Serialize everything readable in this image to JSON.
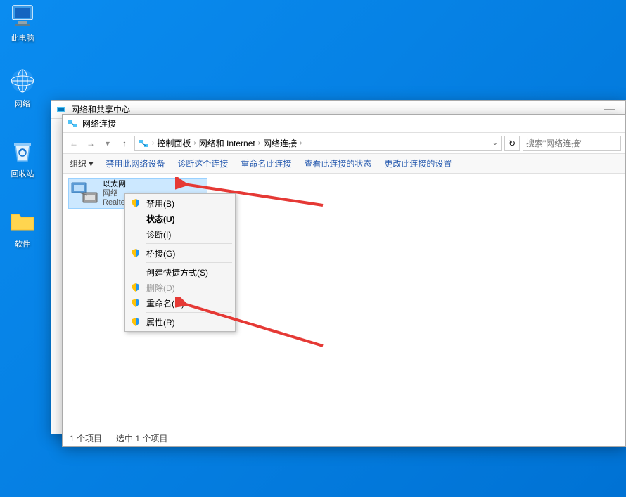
{
  "desktop": {
    "icons": [
      {
        "name": "此电脑"
      },
      {
        "name": "网络"
      },
      {
        "name": "回收站"
      },
      {
        "name": "软件"
      }
    ]
  },
  "window_back": {
    "title": "网络和共享中心"
  },
  "window_front": {
    "title": "网络连接",
    "breadcrumb": {
      "items": [
        "控制面板",
        "网络和 Internet",
        "网络连接"
      ]
    },
    "search_placeholder": "搜索\"网络连接\"",
    "toolbar": {
      "organize": "组织 ▾",
      "disable": "禁用此网络设备",
      "diagnose": "诊断这个连接",
      "rename": "重命名此连接",
      "status": "查看此连接的状态",
      "change": "更改此连接的设置"
    },
    "connection": {
      "name": "以太网",
      "sub1": "网络",
      "sub2": "Realtek"
    },
    "context_menu": {
      "disable": "禁用(B)",
      "status": "状态(U)",
      "diagnose": "诊断(I)",
      "bridge": "桥接(G)",
      "shortcut": "创建快捷方式(S)",
      "delete": "删除(D)",
      "rename": "重命名(M)",
      "properties": "属性(R)"
    },
    "status_bar": {
      "count": "1 个项目",
      "selected": "选中 1 个项目"
    }
  }
}
